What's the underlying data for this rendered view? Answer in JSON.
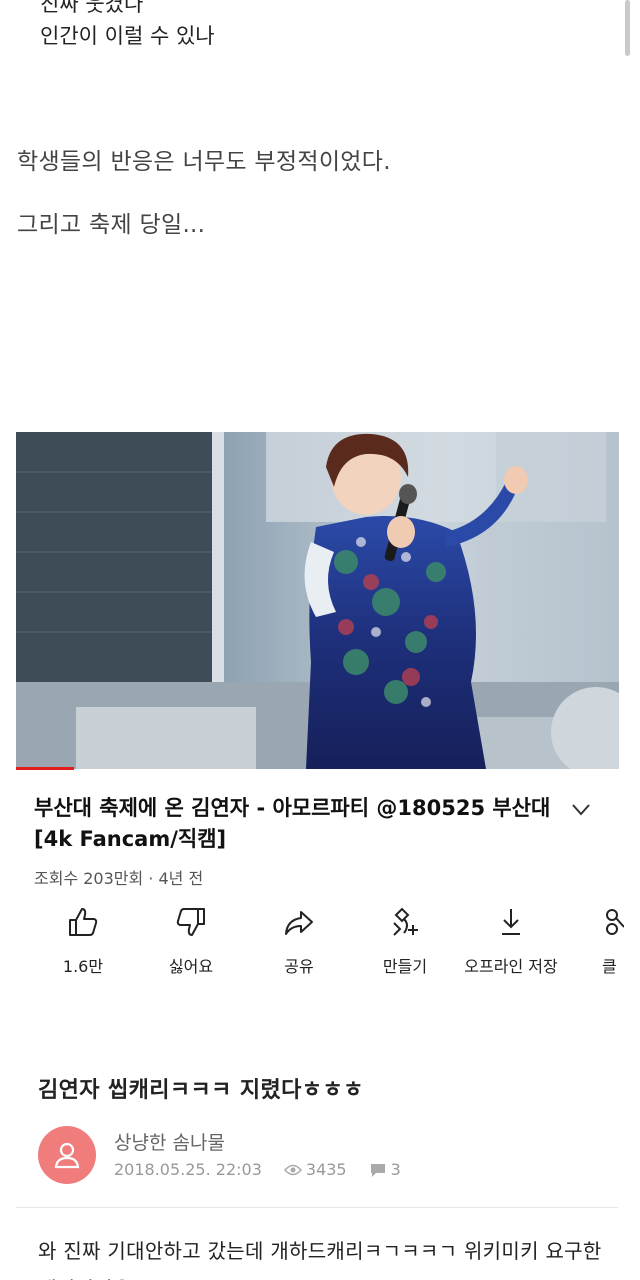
{
  "intro_lines": [
    "진짜 웃겼나",
    "인간이 이럴 수 있나"
  ],
  "paragraphs": [
    "학생들의 반응은 너무도 부정적이었다.",
    "그리고 축제 당일..."
  ],
  "video": {
    "title": "부산대 축제에 온 김연자 - 아모르파티 @180525 부산대 [4k Fancam/직캠]",
    "meta": "조회수 203만회 · 4년 전",
    "actions": {
      "like": "1.6만",
      "dislike": "싫어요",
      "share": "공유",
      "remix": "만들기",
      "offline": "오프라인 저장",
      "clip": "클"
    },
    "icons": [
      "thumbs-up-icon",
      "thumbs-down-icon",
      "share-icon",
      "remix-icon",
      "download-icon",
      "scissors-icon",
      "chevron-down-icon"
    ]
  },
  "post": {
    "title": "김연자 씹캐리ㅋㅋㅋ 지렸다ㅎㅎㅎ",
    "author": "상냥한 솜나물",
    "date": "2018.05.25. 22:03",
    "views": "3435",
    "comments": "3",
    "body": "와 진짜 기대안하고 갔는데 개하드캐리ㅋㄱㅋㅋㄱ 위키미키 요구한 재미었었음"
  },
  "colors": {
    "accent_red": "#e21b1b",
    "avatar_bg": "#f07c7c",
    "text": "#222222",
    "muted": "#999999"
  }
}
